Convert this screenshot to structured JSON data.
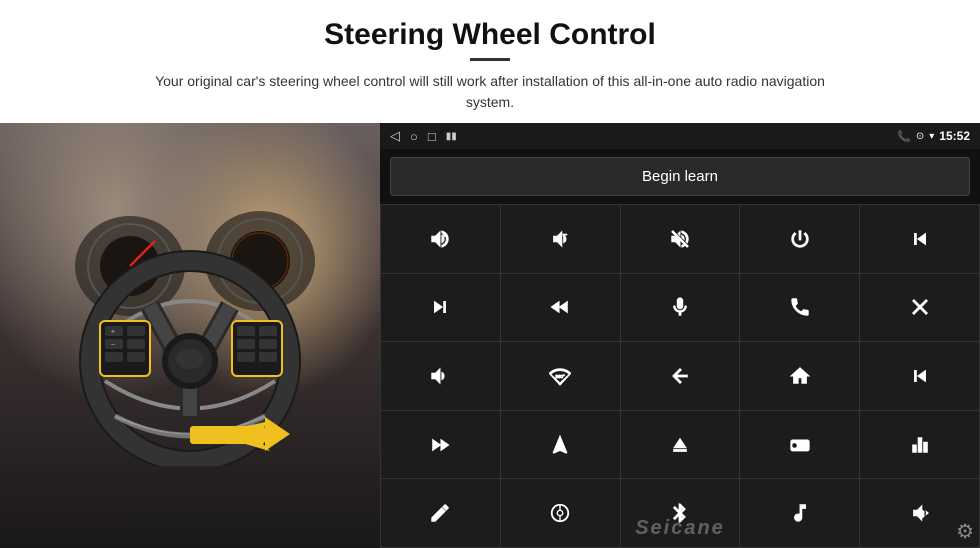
{
  "header": {
    "title": "Steering Wheel Control",
    "subtitle": "Your original car's steering wheel control will still work after installation of this all-in-one auto radio navigation system."
  },
  "status_bar": {
    "nav_back": "◁",
    "nav_home_circle": "○",
    "nav_square": "□",
    "signal_icon": "▪▪",
    "phone_icon": "📞",
    "location_icon": "◈",
    "wifi_icon": "▾",
    "time": "15:52"
  },
  "begin_learn_btn": "Begin learn",
  "watermark": "Seicane",
  "controls": [
    {
      "icon": "vol_up",
      "label": "Volume Up"
    },
    {
      "icon": "vol_down",
      "label": "Volume Down"
    },
    {
      "icon": "mute",
      "label": "Mute"
    },
    {
      "icon": "power",
      "label": "Power"
    },
    {
      "icon": "prev_track",
      "label": "Previous Track"
    },
    {
      "icon": "skip_forward",
      "label": "Skip Forward"
    },
    {
      "icon": "skip_back_fast",
      "label": "Fast Backward"
    },
    {
      "icon": "mic",
      "label": "Microphone"
    },
    {
      "icon": "phone",
      "label": "Phone"
    },
    {
      "icon": "hang_up",
      "label": "Hang Up"
    },
    {
      "icon": "horn",
      "label": "Horn"
    },
    {
      "icon": "360",
      "label": "360 View"
    },
    {
      "icon": "back",
      "label": "Back"
    },
    {
      "icon": "home",
      "label": "Home"
    },
    {
      "icon": "skip_prev",
      "label": "Skip Previous"
    },
    {
      "icon": "fast_forward",
      "label": "Fast Forward"
    },
    {
      "icon": "navigate",
      "label": "Navigation"
    },
    {
      "icon": "eject",
      "label": "Eject"
    },
    {
      "icon": "radio",
      "label": "Radio"
    },
    {
      "icon": "equalizer",
      "label": "Equalizer"
    },
    {
      "icon": "pen",
      "label": "Pen"
    },
    {
      "icon": "steering",
      "label": "Steering"
    },
    {
      "icon": "bluetooth",
      "label": "Bluetooth"
    },
    {
      "icon": "music",
      "label": "Music"
    },
    {
      "icon": "voice_eq",
      "label": "Voice Equalizer"
    }
  ]
}
